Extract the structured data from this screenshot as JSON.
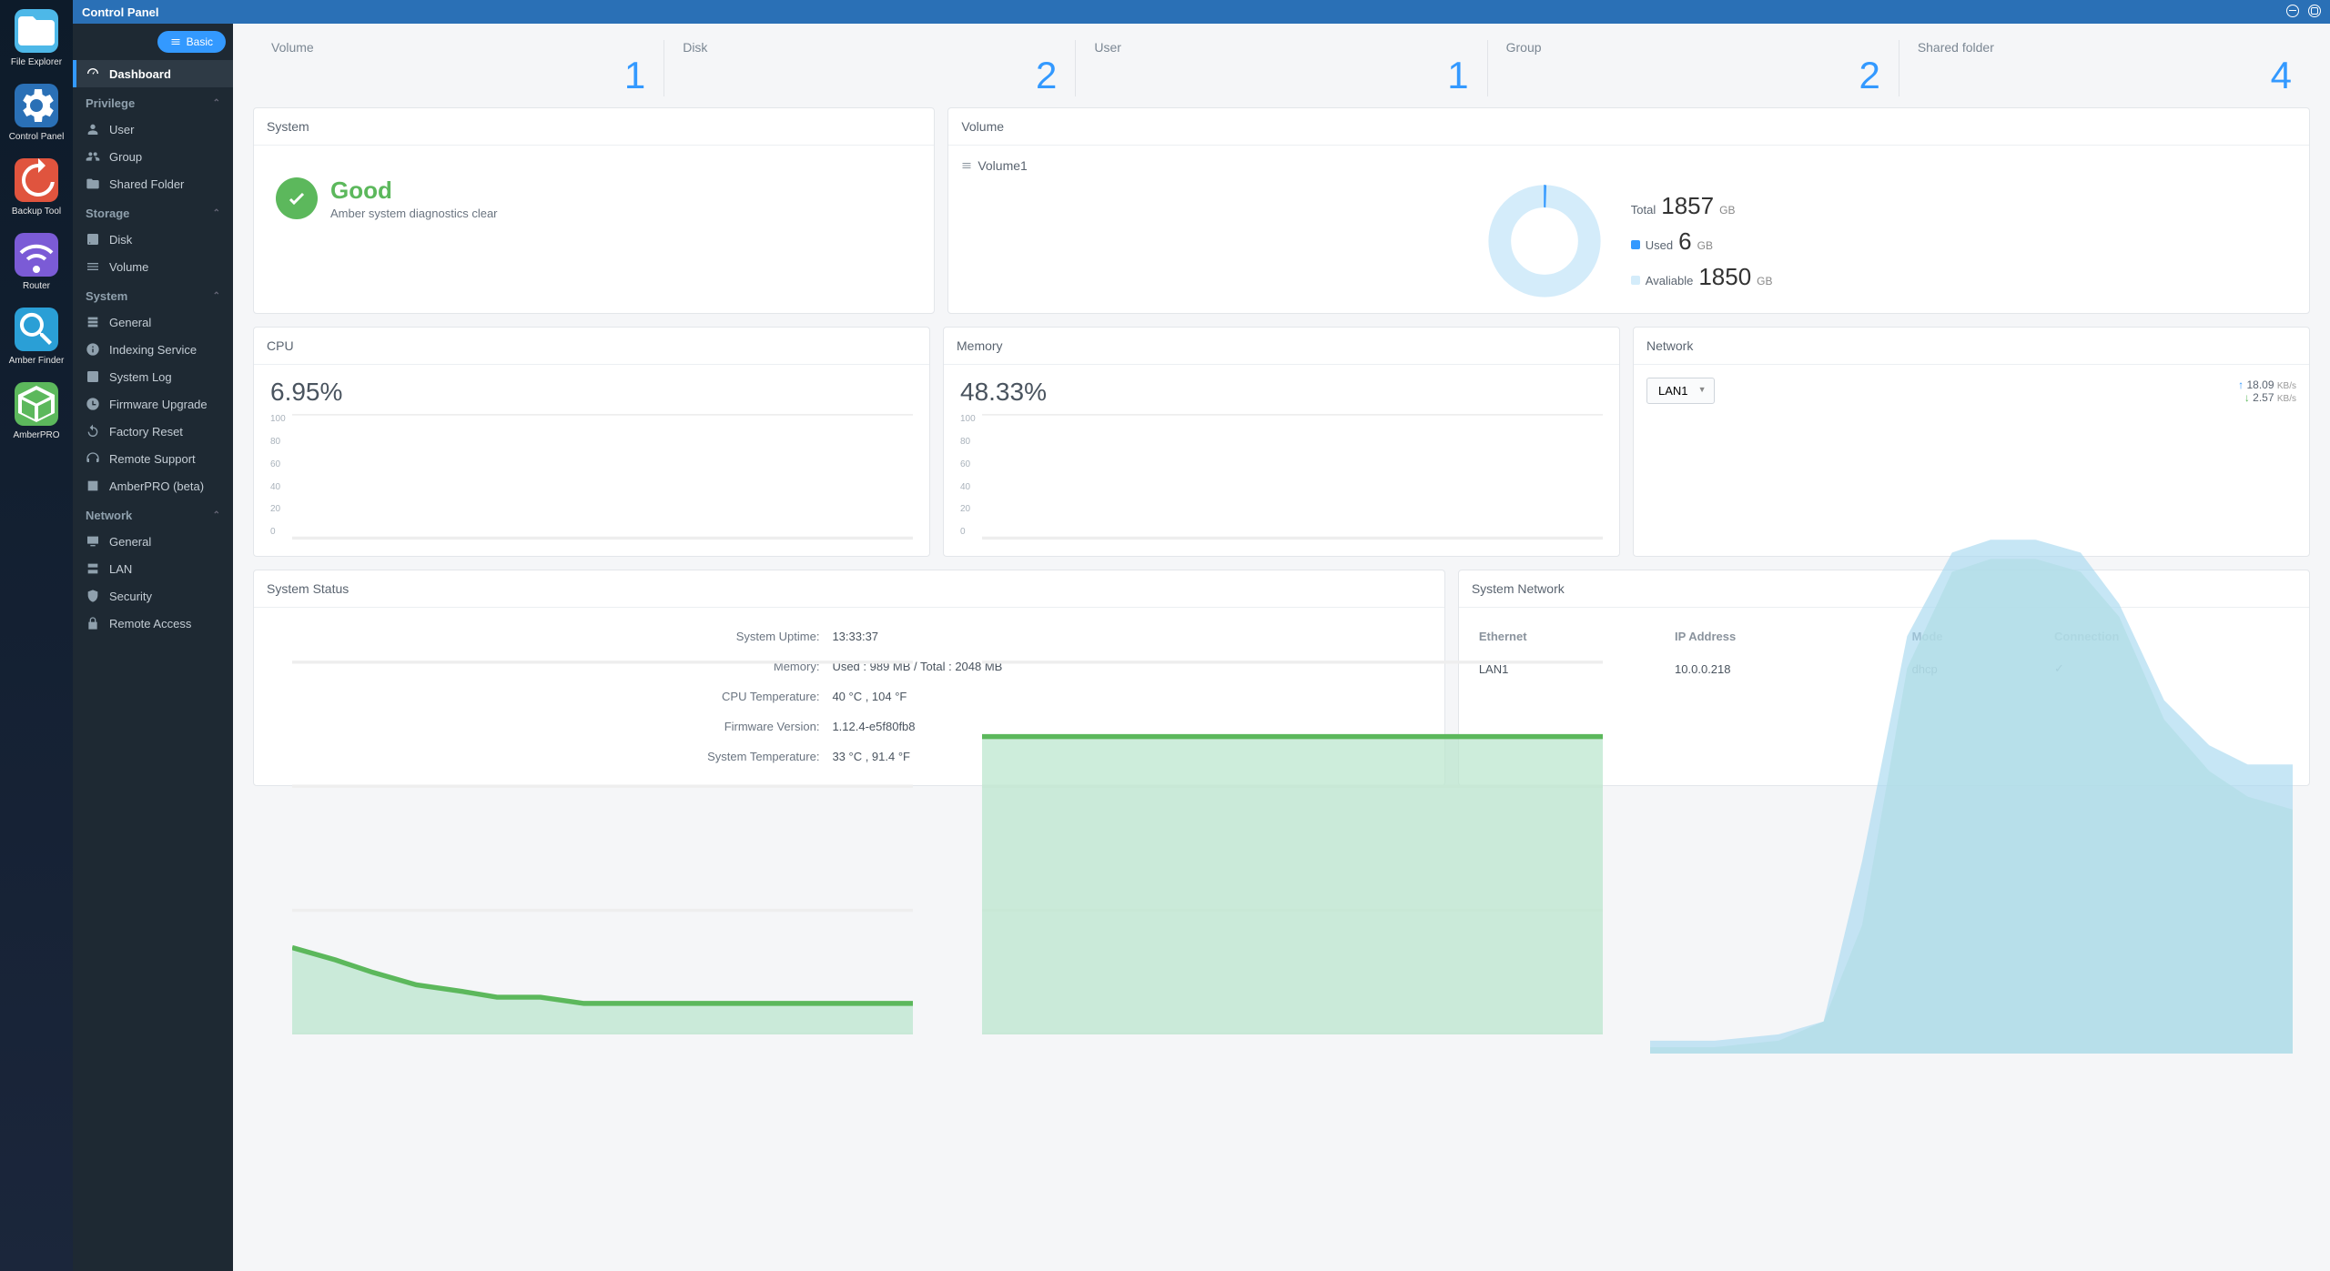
{
  "dock": [
    {
      "label": "File Explorer",
      "color": "#4db8e8"
    },
    {
      "label": "Control Panel",
      "color": "#2a70b6"
    },
    {
      "label": "Backup Tool",
      "color": "#e0543e"
    },
    {
      "label": "Router",
      "color": "#7b5bd6"
    },
    {
      "label": "Amber Finder",
      "color": "#2a9fd6"
    },
    {
      "label": "AmberPRO",
      "color": "#5cb85c"
    }
  ],
  "titlebar": {
    "title": "Control Panel"
  },
  "basic_button": "Basic",
  "nav": {
    "dashboard": "Dashboard",
    "sections": [
      {
        "title": "Privilege",
        "items": [
          "User",
          "Group",
          "Shared Folder"
        ]
      },
      {
        "title": "Storage",
        "items": [
          "Disk",
          "Volume"
        ]
      },
      {
        "title": "System",
        "items": [
          "General",
          "Indexing Service",
          "System Log",
          "Firmware Upgrade",
          "Factory Reset",
          "Remote Support",
          "AmberPRO (beta)"
        ]
      },
      {
        "title": "Network",
        "items": [
          "General",
          "LAN",
          "Security",
          "Remote Access"
        ]
      }
    ]
  },
  "stats": [
    {
      "label": "Volume",
      "value": "1"
    },
    {
      "label": "Disk",
      "value": "2"
    },
    {
      "label": "User",
      "value": "1"
    },
    {
      "label": "Group",
      "value": "2"
    },
    {
      "label": "Shared folder",
      "value": "4"
    }
  ],
  "system_card": {
    "title": "System",
    "status": "Good",
    "subtitle": "Amber system diagnostics clear"
  },
  "volume_card": {
    "title": "Volume",
    "name": "Volume1",
    "total_label": "Total",
    "total_value": "1857",
    "total_unit": "GB",
    "used_label": "Used",
    "used_value": "6",
    "used_unit": "GB",
    "used_color": "#3399ff",
    "avail_label": "Avaliable",
    "avail_value": "1850",
    "avail_unit": "GB",
    "avail_color": "#d4ecfa"
  },
  "cpu_card": {
    "title": "CPU",
    "value": "6.95%"
  },
  "mem_card": {
    "title": "Memory",
    "value": "48.33%"
  },
  "net_card": {
    "title": "Network",
    "selected": "LAN1",
    "up": "18.09",
    "down": "2.57",
    "unit": "KB/s"
  },
  "chart_data": [
    {
      "type": "area",
      "title": "CPU",
      "ylim": [
        0,
        100
      ],
      "ticks": [
        0,
        20,
        40,
        60,
        80,
        100
      ],
      "series": [
        {
          "name": "cpu",
          "color": "#8fd6b8",
          "values": [
            14,
            12,
            10,
            8,
            7,
            6,
            6,
            5,
            5,
            5,
            5,
            5,
            5,
            5,
            5,
            5
          ]
        }
      ]
    },
    {
      "type": "area",
      "title": "Memory",
      "ylim": [
        0,
        100
      ],
      "ticks": [
        0,
        20,
        40,
        60,
        80,
        100
      ],
      "series": [
        {
          "name": "mem",
          "color": "#8fd6b8",
          "values": [
            48,
            48,
            48,
            48,
            48,
            48,
            48,
            48,
            48,
            48,
            48,
            48,
            48,
            48,
            48,
            48
          ]
        }
      ]
    },
    {
      "type": "area",
      "title": "Network",
      "series": [
        {
          "name": "up",
          "color": "#a8d8ef",
          "values": [
            2,
            2,
            3,
            4,
            8,
            30,
            60,
            78,
            80,
            80,
            80,
            78,
            70,
            55,
            48,
            45
          ]
        },
        {
          "name": "down",
          "color": "#c7e8d5",
          "values": [
            1,
            1,
            1,
            2,
            10,
            45,
            65,
            72,
            72,
            70,
            65,
            55,
            40,
            25,
            15,
            10
          ]
        }
      ]
    }
  ],
  "status_card": {
    "title": "System Status",
    "rows": [
      {
        "k": "System Uptime:",
        "v": "13:33:37"
      },
      {
        "k": "Memory:",
        "v": "Used : 989 MB / Total : 2048 MB"
      },
      {
        "k": "CPU Temperature:",
        "v": "40 °C , 104 °F"
      },
      {
        "k": "Firmware Version:",
        "v": "1.12.4-e5f80fb8"
      },
      {
        "k": "System Temperature:",
        "v": "33 °C , 91.4 °F"
      }
    ]
  },
  "sysnet_card": {
    "title": "System Network",
    "headers": [
      "Ethernet",
      "IP Address",
      "Mode",
      "Connection"
    ],
    "rows": [
      {
        "eth": "LAN1",
        "ip": "10.0.0.218",
        "mode": "dhcp",
        "conn": "ok"
      }
    ]
  }
}
